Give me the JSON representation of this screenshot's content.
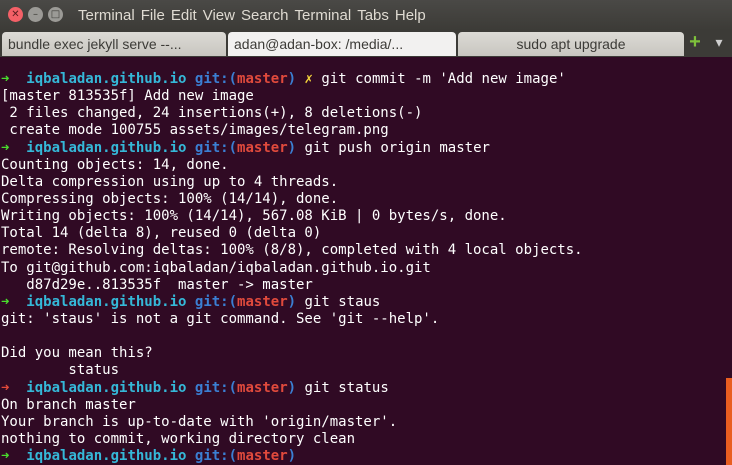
{
  "window": {
    "menu_items": [
      "Terminal",
      "File",
      "Edit",
      "View",
      "Search",
      "Terminal",
      "Tabs",
      "Help"
    ]
  },
  "tabs": [
    {
      "label": "bundle exec jekyll serve --...",
      "active": false
    },
    {
      "label": "adan@adan-box: /media/...",
      "active": true
    },
    {
      "label": "sudo apt upgrade",
      "active": false
    }
  ],
  "terminal": {
    "lines": [
      {
        "kind": "prompt",
        "arrow": "ok",
        "host": "iqbaladan.github.io",
        "git": "git:(",
        "branch": "master",
        "git_close": ")",
        "dirty": "✗",
        "cmd": "git commit -m 'Add new image'"
      },
      {
        "kind": "text",
        "text": "[master 813535f] Add new image"
      },
      {
        "kind": "text",
        "text": " 2 files changed, 24 insertions(+), 8 deletions(-)"
      },
      {
        "kind": "text",
        "text": " create mode 100755 assets/images/telegram.png"
      },
      {
        "kind": "prompt",
        "arrow": "ok",
        "host": "iqbaladan.github.io",
        "git": "git:(",
        "branch": "master",
        "git_close": ")",
        "dirty": "",
        "cmd": "git push origin master"
      },
      {
        "kind": "text",
        "text": "Counting objects: 14, done."
      },
      {
        "kind": "text",
        "text": "Delta compression using up to 4 threads."
      },
      {
        "kind": "text",
        "text": "Compressing objects: 100% (14/14), done."
      },
      {
        "kind": "text",
        "text": "Writing objects: 100% (14/14), 567.08 KiB | 0 bytes/s, done."
      },
      {
        "kind": "text",
        "text": "Total 14 (delta 8), reused 0 (delta 0)"
      },
      {
        "kind": "text",
        "text": "remote: Resolving deltas: 100% (8/8), completed with 4 local objects."
      },
      {
        "kind": "text",
        "text": "To git@github.com:iqbaladan/iqbaladan.github.io.git"
      },
      {
        "kind": "text",
        "text": "   d87d29e..813535f  master -> master"
      },
      {
        "kind": "prompt",
        "arrow": "ok",
        "host": "iqbaladan.github.io",
        "git": "git:(",
        "branch": "master",
        "git_close": ")",
        "dirty": "",
        "cmd": "git staus"
      },
      {
        "kind": "text",
        "text": "git: 'staus' is not a git command. See 'git --help'."
      },
      {
        "kind": "text",
        "text": ""
      },
      {
        "kind": "text",
        "text": "Did you mean this?"
      },
      {
        "kind": "text",
        "text": "        status"
      },
      {
        "kind": "prompt",
        "arrow": "err",
        "host": "iqbaladan.github.io",
        "git": "git:(",
        "branch": "master",
        "git_close": ")",
        "dirty": "",
        "cmd": "git status"
      },
      {
        "kind": "text",
        "text": "On branch master"
      },
      {
        "kind": "text",
        "text": "Your branch is up-to-date with 'origin/master'."
      },
      {
        "kind": "text",
        "text": "nothing to commit, working directory clean"
      },
      {
        "kind": "prompt",
        "arrow": "ok",
        "host": "iqbaladan.github.io",
        "git": "git:(",
        "branch": "master",
        "git_close": ")",
        "dirty": "",
        "cmd": ""
      }
    ]
  },
  "colors": {
    "background": "#300a24",
    "prompt_ok": "#4ade2d",
    "prompt_err": "#e44a3a",
    "host": "#35b8d8",
    "branch": "#e04a3c",
    "scrollbar": "#e95e20"
  }
}
